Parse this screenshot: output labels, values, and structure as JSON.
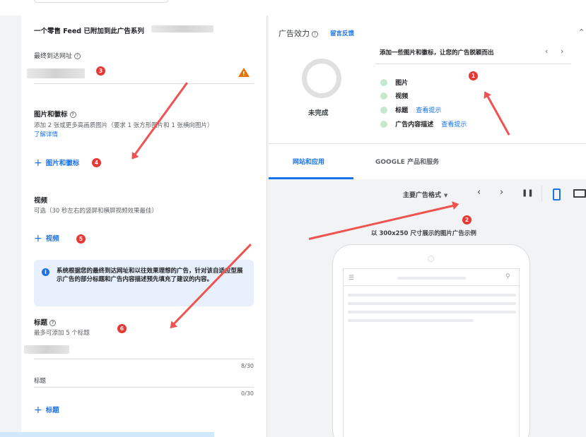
{
  "left": {
    "feed_title": "一个零售 Feed 已附加到此广告系列",
    "final_url_label": "最终到达网址",
    "images_title": "图片和徽标",
    "images_desc": "添加 2 张或更多高画质图片（要求 1 张方形图片和 1 张横向图片）",
    "learn_more": "了解详情",
    "add_images": "图片和徽标",
    "video_title": "视频",
    "video_desc": "可选（30 秒左右的竖屏和横屏视频效果最佳）",
    "add_video": "视频",
    "info_text": "系统根据您的最终到达网址和以往效果理想的广告，针对该自适应型展示广告的部分标题和广告内容描述预先填充了建议的内容。",
    "headline_title": "标题",
    "headline_desc": "最多可添加 5 个标题",
    "counter1": "8/30",
    "headline_placeholder": "标题",
    "counter2": "0/30",
    "add_headline": "标题"
  },
  "right": {
    "strength_title": "广告效力",
    "feedback": "留言反馈",
    "status": "未完成",
    "suggestion": "添加一些图片和徽标，让您的广告脱颖而出",
    "checklist": [
      {
        "label": "图片",
        "link": ""
      },
      {
        "label": "视频",
        "link": ""
      },
      {
        "label": "标题",
        "link": "查看提示"
      },
      {
        "label": "广告内容描述",
        "link": "查看提示"
      }
    ],
    "tabs": [
      "网站和应用",
      "GOOGLE 产品和服务"
    ],
    "format_select": "主要广告格式",
    "preview_caption": "以 300x250 尺寸展示的图片广告示例"
  },
  "badges": [
    "1",
    "2",
    "3",
    "4",
    "5",
    "6"
  ],
  "colors": {
    "accent": "#1a73e8",
    "annotation": "#e53935",
    "warning": "#e37400",
    "check": "#c5e8d0"
  }
}
